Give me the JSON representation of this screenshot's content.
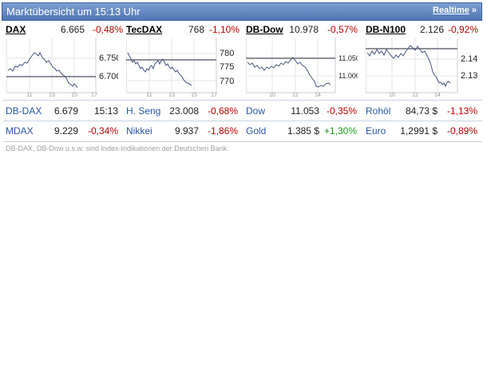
{
  "header": {
    "title": "Marktübersicht um 15:13 Uhr",
    "realtime": "Realtime",
    "realtime_icon": "double-chevron-right-icon"
  },
  "colors": {
    "header": "#4f76b4",
    "label": "#2a56a6",
    "negative": "#c00000",
    "positive": "#1a9a1a"
  },
  "indices": [
    {
      "name": "DAX",
      "value": "6.665",
      "change": "-0,48%",
      "y_ticks": [
        "6.750",
        "6.700"
      ],
      "x_ticks": [
        "11",
        "13",
        "15",
        "17"
      ]
    },
    {
      "name": "TecDAX",
      "value": "768",
      "change": "-1,10%",
      "y_ticks": [
        "780",
        "775",
        "770"
      ],
      "x_ticks": [
        "11",
        "13",
        "15",
        "17"
      ]
    },
    {
      "name": "DB-Dow",
      "value": "10.978",
      "change": "-0,57%",
      "y_ticks": [
        "11.050",
        "11.000"
      ],
      "x_ticks": [
        "10",
        "12",
        "14"
      ]
    },
    {
      "name": "DB-N100",
      "value": "2.126",
      "change": "-0,92%",
      "y_ticks": [
        "2.140",
        "2.130"
      ],
      "x_ticks": [
        "10",
        "12",
        "14"
      ]
    }
  ],
  "rows": [
    [
      {
        "name": "DB-DAX",
        "value": "6.679",
        "change": "15:13"
      },
      {
        "name": "H. Seng",
        "value": "23.008",
        "change": "-0,68%"
      },
      {
        "name": "Dow",
        "value": "11.053",
        "change": "-0,35%"
      },
      {
        "name": "Rohöl",
        "value": "84,73 $",
        "change": "-1,13%"
      }
    ],
    [
      {
        "name": "MDAX",
        "value": "9.229",
        "change": "-0,34%"
      },
      {
        "name": "Nikkei",
        "value": "9.937",
        "change": "-1,86%"
      },
      {
        "name": "Gold",
        "value": "1.385 $",
        "change": "+1,30%"
      },
      {
        "name": "Euro",
        "value": "1,2991 $",
        "change": "-0,89%"
      }
    ]
  ],
  "footnote": "DB-DAX, DB-Dow u.s.w. sind Index-Indikationen der Deutschen Bank."
}
